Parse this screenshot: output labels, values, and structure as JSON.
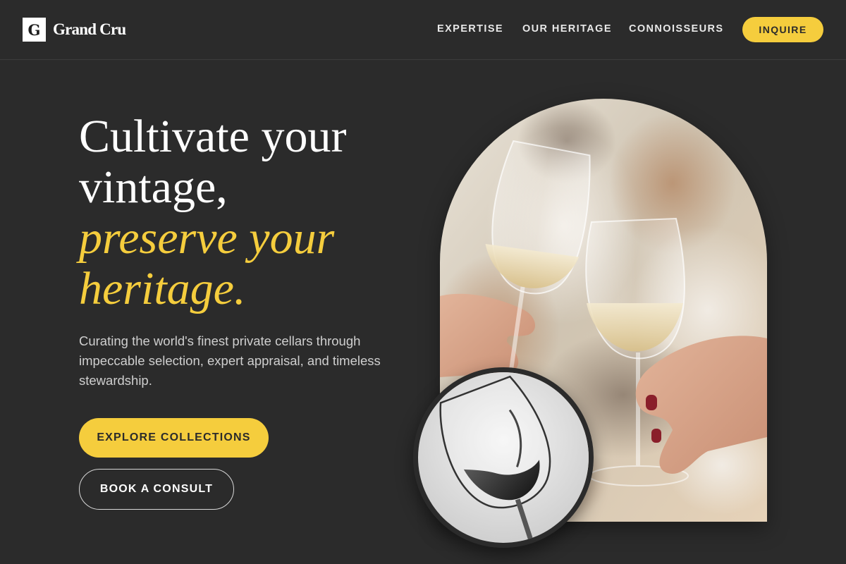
{
  "brand": {
    "logo_letter": "G",
    "name": "Grand Cru"
  },
  "nav": {
    "links": [
      "EXPERTISE",
      "OUR HERITAGE",
      "CONNOISSEURS"
    ],
    "inquire_label": "INQUIRE"
  },
  "hero": {
    "title_line1": "Cultivate your",
    "title_line2": "vintage,",
    "title_accent_line1": "preserve your",
    "title_accent_line2": "heritage.",
    "subtitle": "Curating the world's finest private cellars through impeccable selection, expert appraisal, and timeless stewardship.",
    "primary_cta": "EXPLORE COLLECTIONS",
    "secondary_cta": "BOOK A CONSULT"
  },
  "images": {
    "main_photo": "wine-toast-photo",
    "inset_photo": "wine-glass-swirl-photo"
  },
  "colors": {
    "background": "#2b2b2b",
    "accent": "#f5cd3d",
    "text": "#ffffff",
    "muted_text": "#cfcfcf"
  }
}
